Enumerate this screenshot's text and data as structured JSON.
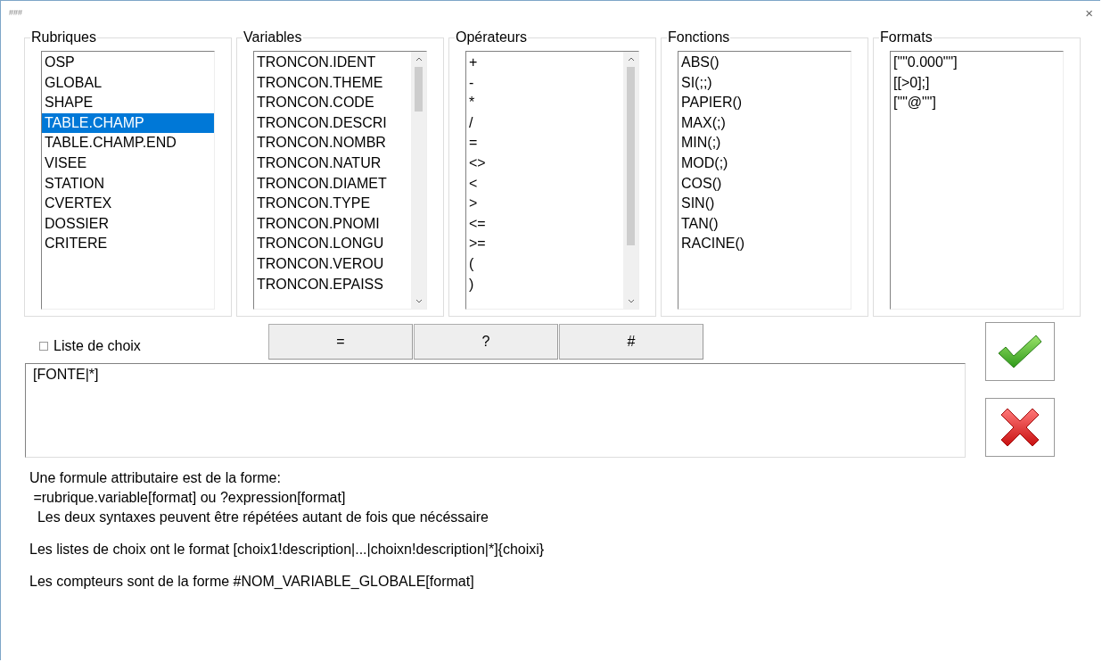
{
  "window": {
    "title": "###",
    "close": "×"
  },
  "groups": [
    {
      "title": "Rubriques",
      "scrollbar": false,
      "items": [
        {
          "label": "OSP",
          "selected": false
        },
        {
          "label": "GLOBAL",
          "selected": false
        },
        {
          "label": "SHAPE",
          "selected": false
        },
        {
          "label": "TABLE.CHAMP",
          "selected": true
        },
        {
          "label": "TABLE.CHAMP.END",
          "selected": false
        },
        {
          "label": "VISEE",
          "selected": false
        },
        {
          "label": "STATION",
          "selected": false
        },
        {
          "label": "CVERTEX",
          "selected": false
        },
        {
          "label": "DOSSIER",
          "selected": false
        },
        {
          "label": "CRITERE",
          "selected": false
        }
      ]
    },
    {
      "title": "Variables",
      "scrollbar": true,
      "items": [
        {
          "label": "TRONCON.IDENT",
          "selected": false
        },
        {
          "label": "TRONCON.THEME",
          "selected": false
        },
        {
          "label": "TRONCON.CODE",
          "selected": false
        },
        {
          "label": "TRONCON.DESCRI",
          "selected": false
        },
        {
          "label": "TRONCON.NOMBR",
          "selected": false
        },
        {
          "label": "TRONCON.NATUR",
          "selected": false
        },
        {
          "label": "TRONCON.DIAMET",
          "selected": false
        },
        {
          "label": "TRONCON.TYPE",
          "selected": false
        },
        {
          "label": "TRONCON.PNOMI",
          "selected": false
        },
        {
          "label": "TRONCON.LONGU",
          "selected": false
        },
        {
          "label": "TRONCON.VEROU",
          "selected": false
        },
        {
          "label": "TRONCON.EPAISS",
          "selected": false
        }
      ]
    },
    {
      "title": "Opérateurs",
      "scrollbar": true,
      "items": [
        {
          "label": "+",
          "selected": false
        },
        {
          "label": "-",
          "selected": false
        },
        {
          "label": "*",
          "selected": false
        },
        {
          "label": "/",
          "selected": false
        },
        {
          "label": "=",
          "selected": false
        },
        {
          "label": "<>",
          "selected": false
        },
        {
          "label": "<",
          "selected": false
        },
        {
          "label": ">",
          "selected": false
        },
        {
          "label": "<=",
          "selected": false
        },
        {
          "label": ">=",
          "selected": false
        },
        {
          "label": "(",
          "selected": false
        },
        {
          "label": ")",
          "selected": false
        }
      ]
    },
    {
      "title": "Fonctions",
      "scrollbar": false,
      "items": [
        {
          "label": "ABS()",
          "selected": false
        },
        {
          "label": "SI(;;)",
          "selected": false
        },
        {
          "label": "PAPIER()",
          "selected": false
        },
        {
          "label": "MAX(;)",
          "selected": false
        },
        {
          "label": "MIN(;)",
          "selected": false
        },
        {
          "label": "MOD(;)",
          "selected": false
        },
        {
          "label": "COS()",
          "selected": false
        },
        {
          "label": "SIN()",
          "selected": false
        },
        {
          "label": "TAN()",
          "selected": false
        },
        {
          "label": "RACINE()",
          "selected": false
        }
      ]
    },
    {
      "title": "Formats",
      "scrollbar": false,
      "items": [
        {
          "label": "[\"\"0.000\"\"]",
          "selected": false
        },
        {
          "label": "[[>0];]",
          "selected": false
        },
        {
          "label": "[\"\"@\"\"]",
          "selected": false
        }
      ]
    }
  ],
  "choice_list": {
    "label": "Liste de choix",
    "checked": false
  },
  "insert_buttons": [
    "=",
    "?",
    "#"
  ],
  "formula": {
    "value": "[FONTE|*]"
  },
  "help": [
    [
      "Une formule attributaire est de la forme:",
      " =rubrique.variable[format] ou ?expression[format]",
      "  Les deux syntaxes peuvent être répétées autant de fois que nécéssaire"
    ],
    [
      "Les listes de choix ont le format [choix1!description|...|choixn!description|*]{choixi}"
    ],
    [
      "Les compteurs sont de la forme #NOM_VARIABLE_GLOBALE[format]"
    ]
  ]
}
